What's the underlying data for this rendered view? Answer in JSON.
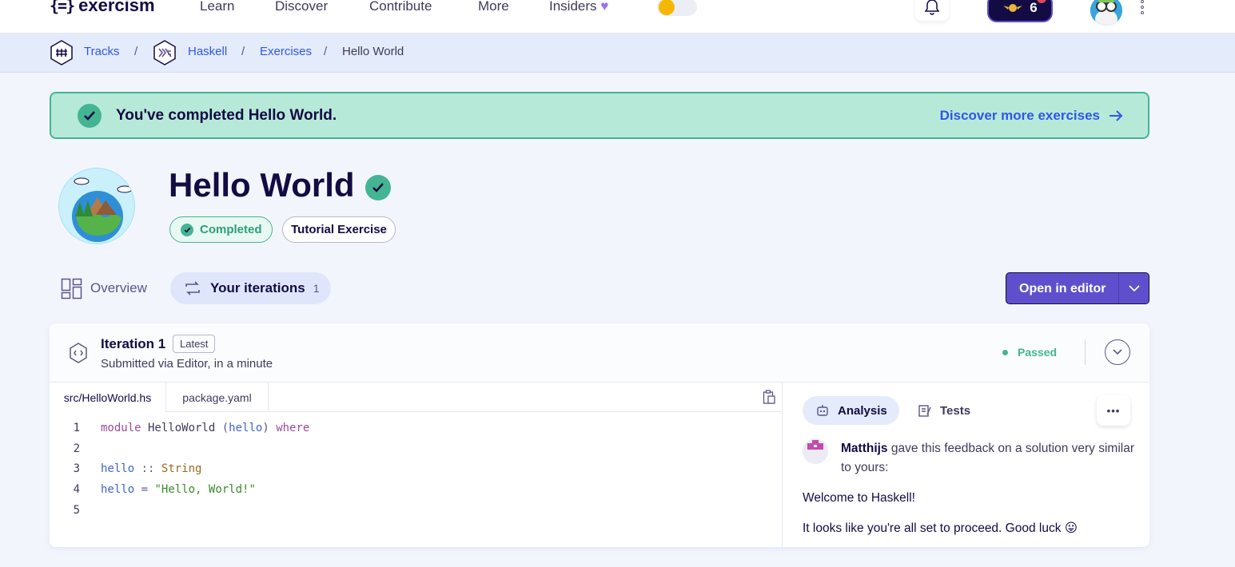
{
  "nav": {
    "brand": "exercism",
    "brand_glyph": "{=}",
    "links": [
      "Learn",
      "Discover",
      "Contribute",
      "More",
      "Insiders"
    ],
    "insiders_icon": "purple-heart",
    "reputation": "6"
  },
  "breadcrumb": {
    "tracks": "Tracks",
    "track": "Haskell",
    "exercises": "Exercises",
    "current": "Hello World",
    "separator": "/"
  },
  "banner": {
    "message": "You've completed Hello World.",
    "discover_label": "Discover more exercises",
    "color": "#b7e9d9"
  },
  "exercise": {
    "title": "Hello World",
    "status_pill": "Completed",
    "type_pill": "Tutorial Exercise"
  },
  "tabs": {
    "overview": "Overview",
    "iterations": "Your iterations",
    "iterations_count": "1"
  },
  "actions": {
    "open_in_editor": "Open in editor"
  },
  "iteration": {
    "title": "Iteration 1",
    "badge": "Latest",
    "subtitle": "Submitted via Editor, in a minute",
    "status": "Passed"
  },
  "files": {
    "tabs": [
      "src/HelloWorld.hs",
      "package.yaml"
    ],
    "code_lines": [
      {
        "num": "1",
        "parts": [
          [
            "kw",
            "module"
          ],
          [
            "plain",
            " HelloWorld "
          ],
          [
            "op",
            "("
          ],
          [
            "id",
            "hello"
          ],
          [
            "op",
            ")"
          ],
          [
            "plain",
            " "
          ],
          [
            "kw",
            "where"
          ]
        ]
      },
      {
        "num": "2",
        "parts": []
      },
      {
        "num": "3",
        "parts": [
          [
            "id",
            "hello"
          ],
          [
            "plain",
            " "
          ],
          [
            "op",
            "::"
          ],
          [
            "plain",
            " "
          ],
          [
            "ty",
            "String"
          ]
        ]
      },
      {
        "num": "4",
        "parts": [
          [
            "id",
            "hello"
          ],
          [
            "plain",
            " "
          ],
          [
            "op",
            "="
          ],
          [
            "plain",
            " "
          ],
          [
            "str",
            "\"Hello, World!\""
          ]
        ]
      },
      {
        "num": "5",
        "parts": []
      }
    ]
  },
  "analysis": {
    "tab_analysis": "Analysis",
    "tab_tests": "Tests",
    "more": "•••",
    "mentor": "Matthijs",
    "mentor_text": " gave this feedback on a solution very similar to yours:",
    "line1": "Welcome to Haskell!",
    "line2": "It looks like you're all set to proceed. Good luck 😛"
  },
  "colors": {
    "accent": "#604fcd",
    "success": "#43b593",
    "link": "#2e57e8",
    "ink": "#130b43"
  }
}
